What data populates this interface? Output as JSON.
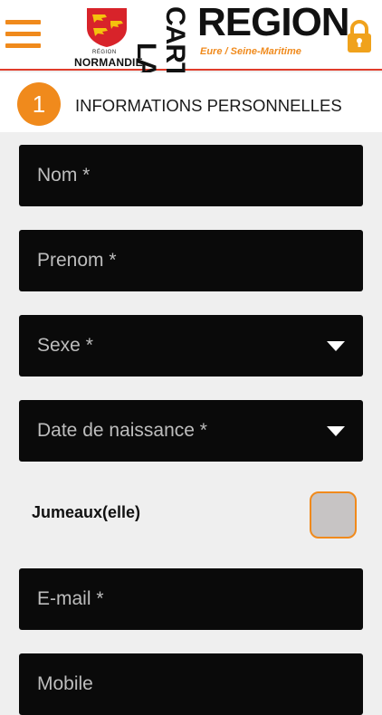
{
  "header": {
    "menu_icon": "hamburger-menu-icon",
    "logo": {
      "region_small": "RÉGION",
      "normandie": "NORMANDIE",
      "la": "LA",
      "carte": "CARTE",
      "region": "REGION",
      "subtitle": "Eure / Seine-Maritime"
    },
    "lock_icon": "lock-icon",
    "accent_color": "#f08a1c",
    "divider_color": "#e03b2a"
  },
  "section": {
    "step_number": "1",
    "title": "INFORMATIONS PERSONNELLES"
  },
  "form": {
    "nom_placeholder": "Nom *",
    "prenom_placeholder": "Prenom *",
    "sexe_placeholder": "Sexe *",
    "date_placeholder": "Date de naissance *",
    "jumeaux_label": "Jumeaux(elle)",
    "jumeaux_checked": false,
    "email_placeholder": "E-mail *",
    "mobile_placeholder": "Mobile"
  }
}
